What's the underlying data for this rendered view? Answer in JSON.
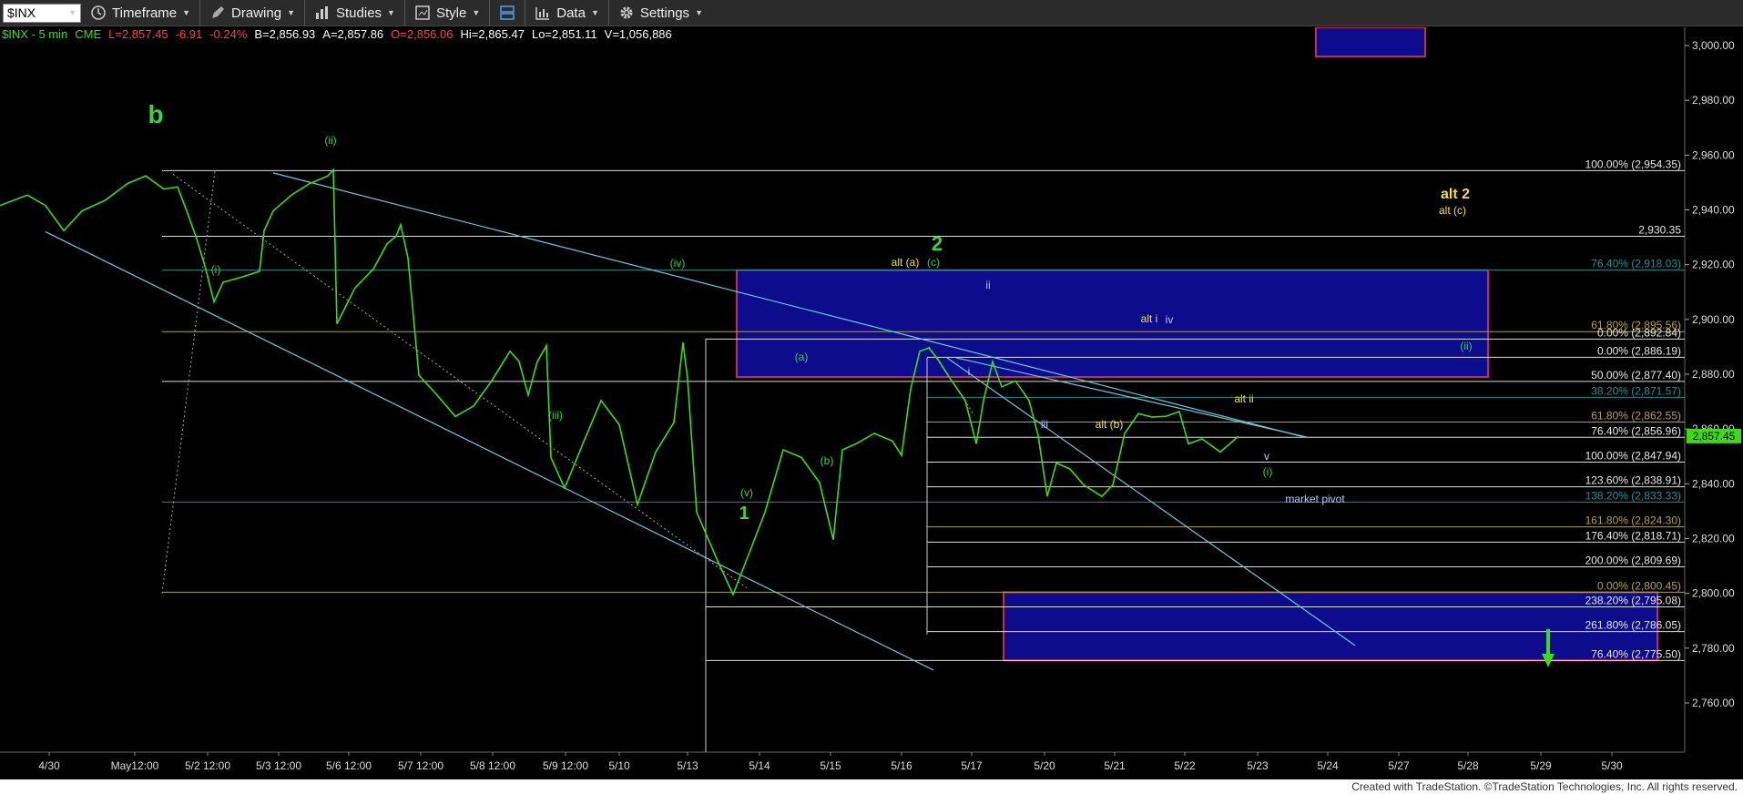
{
  "toolbar": {
    "symbol": "$INX",
    "items": [
      "Timeframe",
      "Drawing",
      "Studies",
      "Style",
      "Data",
      "Settings"
    ]
  },
  "infobar": {
    "symbol": "$INX - 5 min",
    "exchange": "CME",
    "last": "L=2,857.45",
    "change": "-6.91",
    "change_pct": "-0.24%",
    "bid": "B=2,856.93",
    "ask": "A=2,857.86",
    "open": "O=2,856.06",
    "high": "Hi=2,865.47",
    "low": "Lo=2,851.11",
    "volume": "V=1,056,886"
  },
  "colors": {
    "price": "#3cdc14",
    "channel": "#6fc8e0",
    "box_fill": "#0c0c8c",
    "box_border": "#c0304a",
    "yellow_label": "#f0e040",
    "green_label": "#40d040",
    "last_price_tag": "#3cdc14"
  },
  "price_axis": {
    "ticks": [
      "3,000.00",
      "2,980.00",
      "2,960.00",
      "2,940.00",
      "2,920.00",
      "2,900.00",
      "2,880.00",
      "2,860.00",
      "2,840.00",
      "2,820.00",
      "2,800.00",
      "2,780.00",
      "2,760.00"
    ],
    "current": "2,857.45"
  },
  "time_axis": [
    "4/30",
    "May12:00",
    "5/2 12:00",
    "5/3 12:00",
    "5/6 12:00",
    "5/7 12:00",
    "5/8 12:00",
    "5/9 12:00",
    "5/10",
    "5/13",
    "5/14",
    "5/15",
    "5/16",
    "5/17",
    "5/20",
    "5/21",
    "5/22",
    "5/23",
    "5/24",
    "5/27",
    "5/28",
    "5/29",
    "5/30"
  ],
  "fib_levels": [
    {
      "label": "100.00% (2,954.35)",
      "price": 2954.35
    },
    {
      "label": "2,930.35",
      "price": 2930.35
    },
    {
      "label": "76.40% (2,918.03)",
      "price": 2918.03
    },
    {
      "label": "61.80% (2,895.56)",
      "price": 2895.56
    },
    {
      "label": "0.00% (2,892.84)",
      "price": 2892.84
    },
    {
      "label": "0.00% (2,886.19)",
      "price": 2886.19
    },
    {
      "label": "50.00% (2,877.40)",
      "price": 2877.4
    },
    {
      "label": "38.20% (2,871.57)",
      "price": 2871.57
    },
    {
      "label": "61.80% (2,862.55)",
      "price": 2862.55
    },
    {
      "label": "76.40% (2,856.96)",
      "price": 2856.96
    },
    {
      "label": "100.00% (2,847.94)",
      "price": 2847.94
    },
    {
      "label": "123.60% (2,838.91)",
      "price": 2838.91
    },
    {
      "label": "138.20% (2,833.33)",
      "price": 2833.33
    },
    {
      "label": "161.80% (2,824.30)",
      "price": 2824.3
    },
    {
      "label": "176.40% (2,818.71)",
      "price": 2818.71
    },
    {
      "label": "200.00% (2,809.69)",
      "price": 2809.69
    },
    {
      "label": "0.00% (2,800.45)",
      "price": 2800.45
    },
    {
      "label": "238.20% (2,795.08)",
      "price": 2795.08
    },
    {
      "label": "261.80% (2,786.05)",
      "price": 2786.05
    },
    {
      "label": "76.40% (2,775.50)",
      "price": 2775.5
    }
  ],
  "wave_labels": [
    {
      "text": "b",
      "color": "green",
      "big": true
    },
    {
      "text": "(i)",
      "color": "green"
    },
    {
      "text": "(ii)",
      "color": "green"
    },
    {
      "text": "(iii)",
      "color": "green"
    },
    {
      "text": "(iv)",
      "color": "green"
    },
    {
      "text": "(v)",
      "color": "green"
    },
    {
      "text": "1",
      "color": "green",
      "big": true
    },
    {
      "text": "(a)",
      "color": "green"
    },
    {
      "text": "(b)",
      "color": "green"
    },
    {
      "text": "2",
      "color": "green",
      "big": true
    },
    {
      "text": "(c)",
      "color": "green"
    },
    {
      "text": "alt (a)",
      "color": "yellow"
    },
    {
      "text": "i",
      "color": "white"
    },
    {
      "text": "ii",
      "color": "white"
    },
    {
      "text": "iii",
      "color": "white"
    },
    {
      "text": "iv",
      "color": "white"
    },
    {
      "text": "v",
      "color": "white"
    },
    {
      "text": "alt i",
      "color": "yellow"
    },
    {
      "text": "alt ii",
      "color": "yellow"
    },
    {
      "text": "alt (b)",
      "color": "yellow"
    },
    {
      "text": "(ii)",
      "color": "green"
    },
    {
      "text": "(i)",
      "color": "green"
    },
    {
      "text": "alt 2",
      "color": "yellow",
      "big": true
    },
    {
      "text": "alt (c)",
      "color": "yellow"
    },
    {
      "text": "market pivot",
      "color": "white"
    }
  ],
  "footer": "Created with TradeStation. ©TradeStation Technologies, Inc. All rights reserved."
}
